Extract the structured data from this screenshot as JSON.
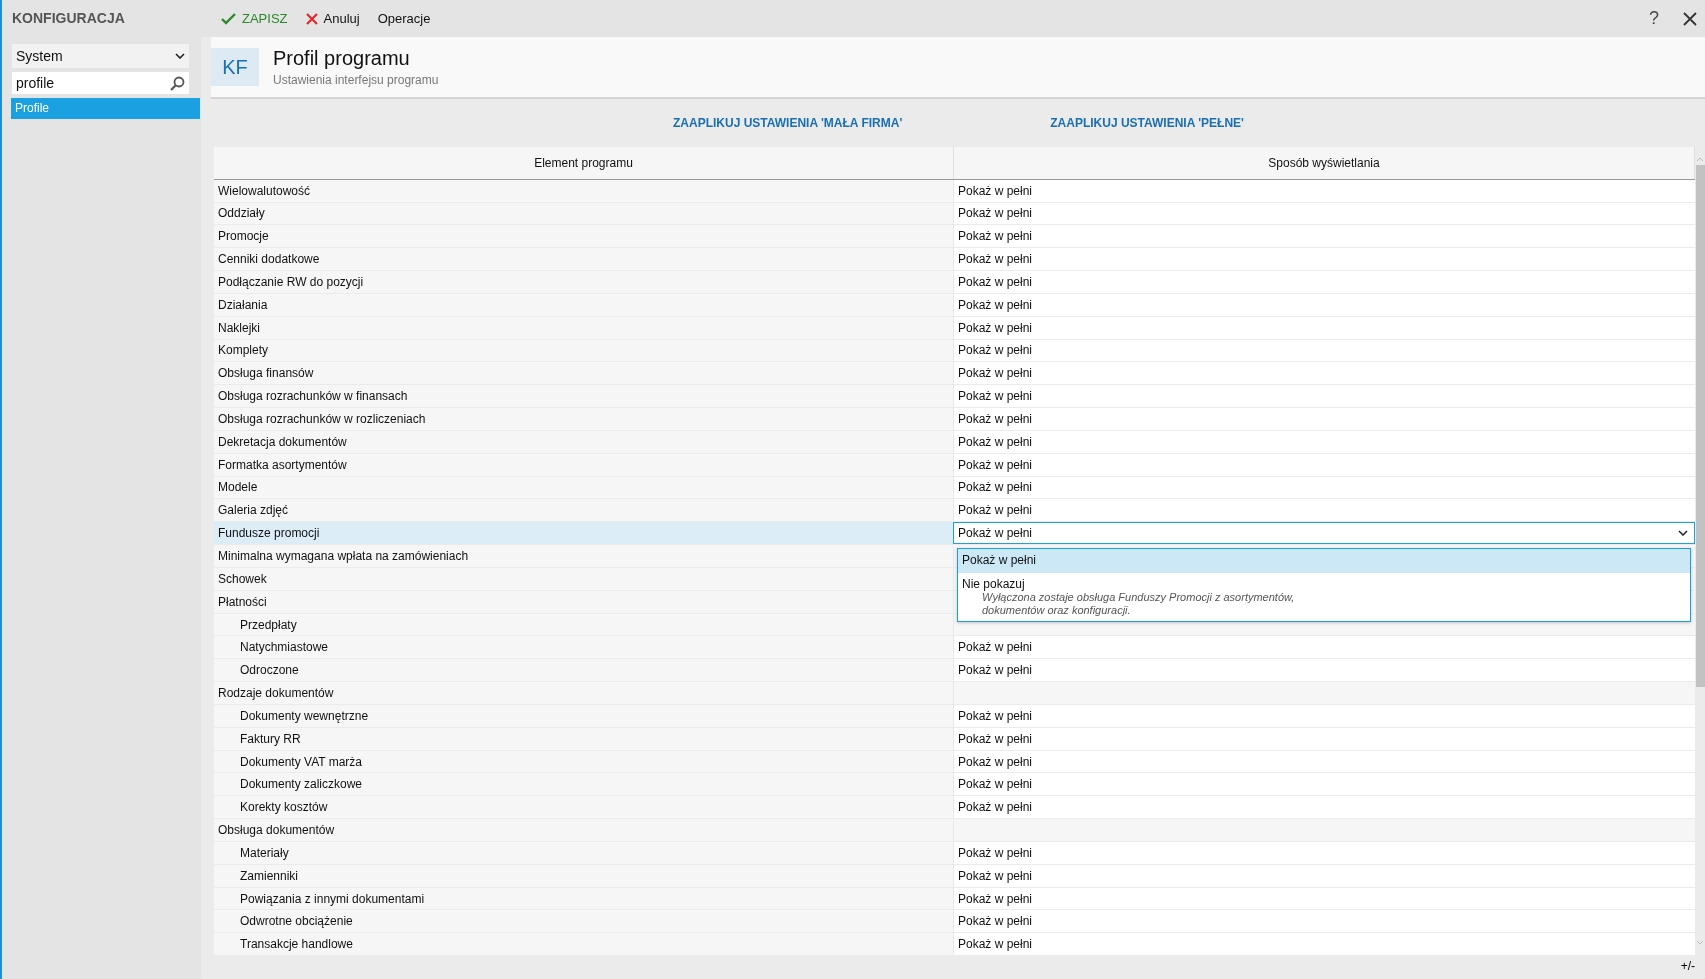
{
  "sidebar": {
    "title": "KONFIGURACJA",
    "category": "System",
    "search": {
      "value": "profile"
    },
    "items": [
      {
        "label": "Profile",
        "selected": true
      }
    ]
  },
  "toolbar": {
    "save": "ZAPISZ",
    "cancel": "Anuluj",
    "operations": "Operacje",
    "help": "?"
  },
  "header": {
    "badge": "KF",
    "title": "Profil programu",
    "subtitle": "Ustawienia interfejsu programu"
  },
  "apply_links": [
    "ZAAPLIKUJ USTAWIENIA 'MAŁA FIRMA'",
    "ZAAPLIKUJ USTAWIENIA 'PEŁNE'"
  ],
  "table": {
    "columns": [
      "Element programu",
      "Sposób wyświetlania"
    ],
    "rows": [
      {
        "element": "Wielowalutowość",
        "value": "Pokaż w pełni",
        "selected": false
      },
      {
        "element": "Oddziały",
        "value": "Pokaż w pełni",
        "selected": false
      },
      {
        "element": "Promocje",
        "value": "Pokaż w pełni",
        "selected": false
      },
      {
        "element": "Cenniki dodatkowe",
        "value": "Pokaż w pełni",
        "selected": false
      },
      {
        "element": "Podłączanie RW do pozycji",
        "value": "Pokaż w pełni",
        "selected": false
      },
      {
        "element": "Działania",
        "value": "Pokaż w pełni",
        "selected": false
      },
      {
        "element": "Naklejki",
        "value": "Pokaż w pełni",
        "selected": false
      },
      {
        "element": "Komplety",
        "value": "Pokaż w pełni",
        "selected": false
      },
      {
        "element": "Obsługa finansów",
        "value": "Pokaż w pełni",
        "selected": false
      },
      {
        "element": "Obsługa rozrachunków w finansach",
        "value": "Pokaż w pełni",
        "selected": false
      },
      {
        "element": "Obsługa rozrachunków w rozliczeniach",
        "value": "Pokaż w pełni",
        "selected": false
      },
      {
        "element": "Dekretacja dokumentów",
        "value": "Pokaż w pełni",
        "selected": false
      },
      {
        "element": "Formatka asortymentów",
        "value": "Pokaż w pełni",
        "selected": false
      },
      {
        "element": "Modele",
        "value": "Pokaż w pełni",
        "selected": false
      },
      {
        "element": "Galeria zdjęć",
        "value": "Pokaż w pełni",
        "selected": false
      },
      {
        "element": "Fundusze promocji",
        "value": "Pokaż w pełni",
        "selected": true,
        "dropdown": {
          "options": [
            {
              "label": "Pokaż w pełni",
              "selected": true
            },
            {
              "label": "Nie pokazuj",
              "description": "Wyłączona zostaje obsługa Funduszy Promocji z asortymentów,\ndokumentów oraz konfiguracji.",
              "selected": false
            }
          ]
        }
      },
      {
        "element": "Minimalna wymagana wpłata na zamówieniach",
        "selected": false
      },
      {
        "element": "Schowek",
        "selected": false
      },
      {
        "element": "Płatności",
        "selected": false,
        "children": [
          {
            "element": "Przedpłaty",
            "selected": false
          },
          {
            "element": "Natychmiastowe",
            "value": "Pokaż w pełni",
            "selected": false
          },
          {
            "element": "Odroczone",
            "value": "Pokaż w pełni",
            "selected": false
          }
        ]
      },
      {
        "element": "Rodzaje dokumentów",
        "selected": false,
        "children": [
          {
            "element": "Dokumenty wewnętrzne",
            "value": "Pokaż w pełni",
            "selected": false
          },
          {
            "element": "Faktury RR",
            "value": "Pokaż w pełni",
            "selected": false
          },
          {
            "element": "Dokumenty VAT marża",
            "value": "Pokaż w pełni",
            "selected": false
          },
          {
            "element": "Dokumenty zaliczkowe",
            "value": "Pokaż w pełni",
            "selected": false
          },
          {
            "element": "Korekty kosztów",
            "value": "Pokaż w pełni",
            "selected": false
          }
        ]
      },
      {
        "element": "Obsługa dokumentów",
        "selected": false,
        "children": [
          {
            "element": "Materiały",
            "value": "Pokaż w pełni",
            "selected": false
          },
          {
            "element": "Zamienniki",
            "value": "Pokaż w pełni",
            "selected": false
          },
          {
            "element": "Powiązania z innymi dokumentami",
            "value": "Pokaż w pełni",
            "selected": false
          },
          {
            "element": "Odwrotne obciążenie",
            "value": "Pokaż w pełni",
            "selected": false
          },
          {
            "element": "Transakcje handlowe",
            "value": "Pokaż w pełni",
            "selected": false
          }
        ]
      }
    ]
  },
  "footer": {
    "toggle": "+/-"
  }
}
